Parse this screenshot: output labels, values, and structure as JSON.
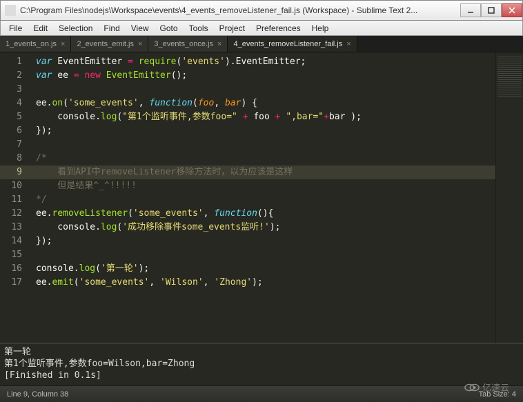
{
  "window": {
    "title": "C:\\Program Files\\nodejs\\Workspace\\events\\4_events_removeListener_fail.js (Workspace) - Sublime Text 2..."
  },
  "menu": {
    "items": [
      "File",
      "Edit",
      "Selection",
      "Find",
      "View",
      "Goto",
      "Tools",
      "Project",
      "Preferences",
      "Help"
    ]
  },
  "tabs": [
    {
      "label": "1_events_on.js",
      "active": false
    },
    {
      "label": "2_events_emit.js",
      "active": false
    },
    {
      "label": "3_events_once.js",
      "active": false
    },
    {
      "label": "4_events_removeListener_fail.js",
      "active": true
    }
  ],
  "editor": {
    "highlight_line": 9,
    "lines": [
      {
        "n": 1,
        "html": "<span class='kw'>var</span> EventEmitter <span class='kw2'>=</span> <span class='fn'>require</span>(<span class='str'>'events'</span>).EventEmitter;"
      },
      {
        "n": 2,
        "html": "<span class='kw'>var</span> ee <span class='kw2'>=</span> <span class='kw2'>new</span> <span class='fn'>EventEmitter</span>();"
      },
      {
        "n": 3,
        "html": ""
      },
      {
        "n": 4,
        "html": "ee.<span class='fn'>on</span>(<span class='str'>'some_events'</span>, <span class='kw'>function</span>(<span class='arg'>foo</span>, <span class='arg'>bar</span>) {"
      },
      {
        "n": 5,
        "html": "    console.<span class='fn'>log</span>(<span class='str'>\"第1个监听事件,参数foo=\"</span> <span class='kw2'>+</span> foo <span class='kw2'>+</span> <span class='str'>\",bar=\"</span><span class='kw2'>+</span>bar );"
      },
      {
        "n": 6,
        "html": "});"
      },
      {
        "n": 7,
        "html": ""
      },
      {
        "n": 8,
        "html": "<span class='cm'>/*</span>"
      },
      {
        "n": 9,
        "html": "<span class='cm'>    看到API中removeListener移除方法时，以为应该是这样</span>"
      },
      {
        "n": 10,
        "html": "<span class='cm'>    但是结果^_^!!!!!</span>"
      },
      {
        "n": 11,
        "html": "<span class='cm'>*/</span>"
      },
      {
        "n": 12,
        "html": "ee.<span class='fn'>removeListener</span>(<span class='str'>'some_events'</span>, <span class='kw'>function</span>(){"
      },
      {
        "n": 13,
        "html": "    console.<span class='fn'>log</span>(<span class='str'>'成功移除事件some_events监听!'</span>);"
      },
      {
        "n": 14,
        "html": "});"
      },
      {
        "n": 15,
        "html": ""
      },
      {
        "n": 16,
        "html": "console.<span class='fn'>log</span>(<span class='str'>'第一轮'</span>);"
      },
      {
        "n": 17,
        "html": "ee.<span class='fn'>emit</span>(<span class='str'>'some_events'</span>, <span class='str'>'Wilson'</span>, <span class='str'>'Zhong'</span>);"
      }
    ]
  },
  "console": {
    "lines": [
      "第一轮",
      "第1个监听事件,参数foo=Wilson,bar=Zhong",
      "[Finished in 0.1s]"
    ]
  },
  "statusbar": {
    "left": "Line 9, Column 38",
    "right": "Tab Size: 4"
  },
  "watermark": "亿速云"
}
